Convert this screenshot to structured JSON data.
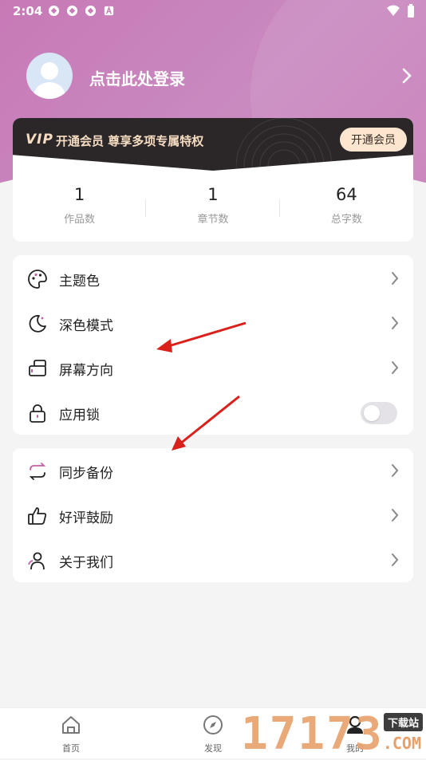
{
  "status_bar": {
    "time": "2:04"
  },
  "profile": {
    "login_text": "点击此处登录"
  },
  "vip": {
    "logo": "VIP",
    "promo_text": "开通会员 尊享多项专属特权",
    "button_label": "开通会员"
  },
  "stats": [
    {
      "value": "1",
      "label": "作品数"
    },
    {
      "value": "1",
      "label": "章节数"
    },
    {
      "value": "64",
      "label": "总字数"
    }
  ],
  "settings_menu": {
    "items": [
      {
        "label": "主题色",
        "icon": "palette-icon"
      },
      {
        "label": "深色模式",
        "icon": "moon-icon"
      },
      {
        "label": "屏幕方向",
        "icon": "screen-rotate-icon"
      },
      {
        "label": "应用锁",
        "icon": "lock-icon",
        "toggle_on": false
      }
    ]
  },
  "misc_menu": {
    "items": [
      {
        "label": "同步备份",
        "icon": "sync-icon"
      },
      {
        "label": "好评鼓励",
        "icon": "thumbs-up-icon"
      },
      {
        "label": "关于我们",
        "icon": "users-icon"
      }
    ]
  },
  "tabbar": {
    "tabs": [
      {
        "label": "首页",
        "icon": "home-icon"
      },
      {
        "label": "发现",
        "icon": "compass-icon"
      },
      {
        "label": "我的",
        "icon": "profile-icon"
      }
    ]
  },
  "watermark": {
    "digits": "17173",
    "tag": "下载站",
    "suffix": ".COM"
  },
  "colors": {
    "hero": "#c87db8",
    "vip_bg": "#2b2729",
    "vip_gold": "#f6dcc0",
    "accent": "#c060a8",
    "annotation": "#d9201b"
  }
}
